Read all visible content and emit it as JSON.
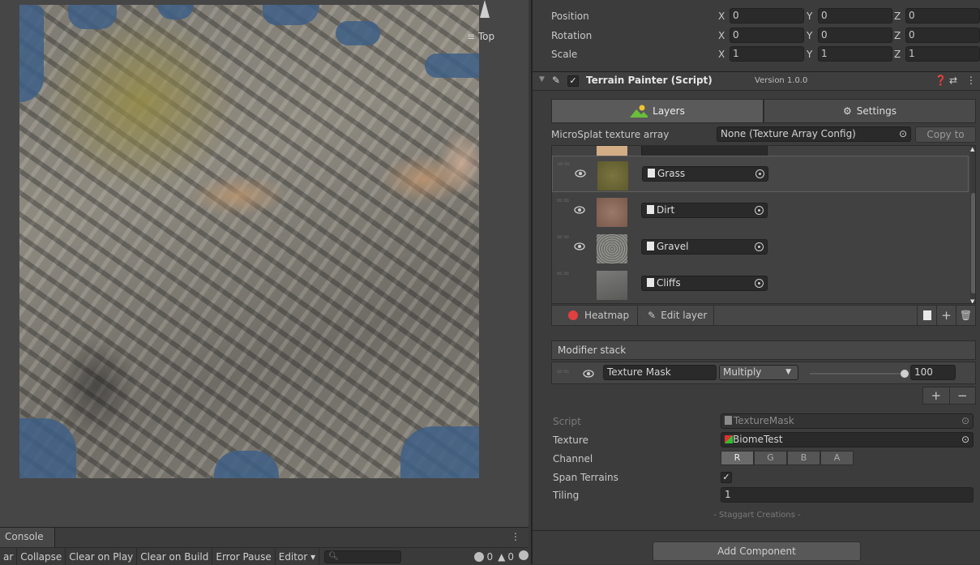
{
  "scene": {
    "view_label": "Top"
  },
  "console": {
    "tab_label": "Console",
    "toolbar": {
      "clear": "ar",
      "collapse": "Collapse",
      "clear_on_play": "Clear on Play",
      "clear_on_build": "Clear on Build",
      "error_pause": "Error Pause",
      "editor": "Editor",
      "search_placeholder": "",
      "log_count": "0",
      "warning_count": "0"
    }
  },
  "transform": {
    "position": {
      "label": "Position",
      "x": "0",
      "y": "0",
      "z": "0"
    },
    "rotation": {
      "label": "Rotation",
      "x": "0",
      "y": "0",
      "z": "0"
    },
    "scale": {
      "label": "Scale",
      "x": "1",
      "y": "1",
      "z": "1"
    },
    "axis_x": "X",
    "axis_y": "Y",
    "axis_z": "Z"
  },
  "component": {
    "title": "Terrain Painter (Script)",
    "version": "Version 1.0.0"
  },
  "tabs": [
    {
      "label": "Layers",
      "active": true
    },
    {
      "label": "Settings",
      "active": false
    }
  ],
  "microsplat": {
    "label": "MicroSplat texture array",
    "value": "None (Texture Array Config)",
    "copy_button": "Copy to"
  },
  "layers": [
    {
      "name": "Grass",
      "visible": true,
      "selected": true,
      "color": "#6b6532"
    },
    {
      "name": "Dirt",
      "visible": true,
      "selected": false,
      "color": "#8d6a5c"
    },
    {
      "name": "Gravel",
      "visible": true,
      "selected": false,
      "color": "#8a8a86"
    },
    {
      "name": "Cliffs",
      "visible": false,
      "selected": false,
      "color": "#6c6c6a"
    }
  ],
  "layer_toolbar": {
    "heatmap": "Heatmap",
    "edit_layer": "Edit layer"
  },
  "modifier_stack": {
    "title": "Modifier stack",
    "modifier": {
      "name": "Texture Mask",
      "blend_mode": "Multiply",
      "opacity": "100",
      "opacity_fraction": 1.0
    }
  },
  "mask_settings": {
    "script_label": "Script",
    "script_value": "TextureMask",
    "texture_label": "Texture",
    "texture_value": "BiomeTest",
    "channel_label": "Channel",
    "channels": [
      "R",
      "G",
      "B",
      "A"
    ],
    "active_channel": "R",
    "span_label": "Span Terrains",
    "span_checked": true,
    "tiling_label": "Tiling",
    "tiling_value": "1"
  },
  "footer": {
    "credit": "- Staggart Creations -",
    "add_component": "Add Component"
  },
  "colors": {
    "accent_record": "#e04040",
    "selected_channel": "#6a6a6a"
  }
}
